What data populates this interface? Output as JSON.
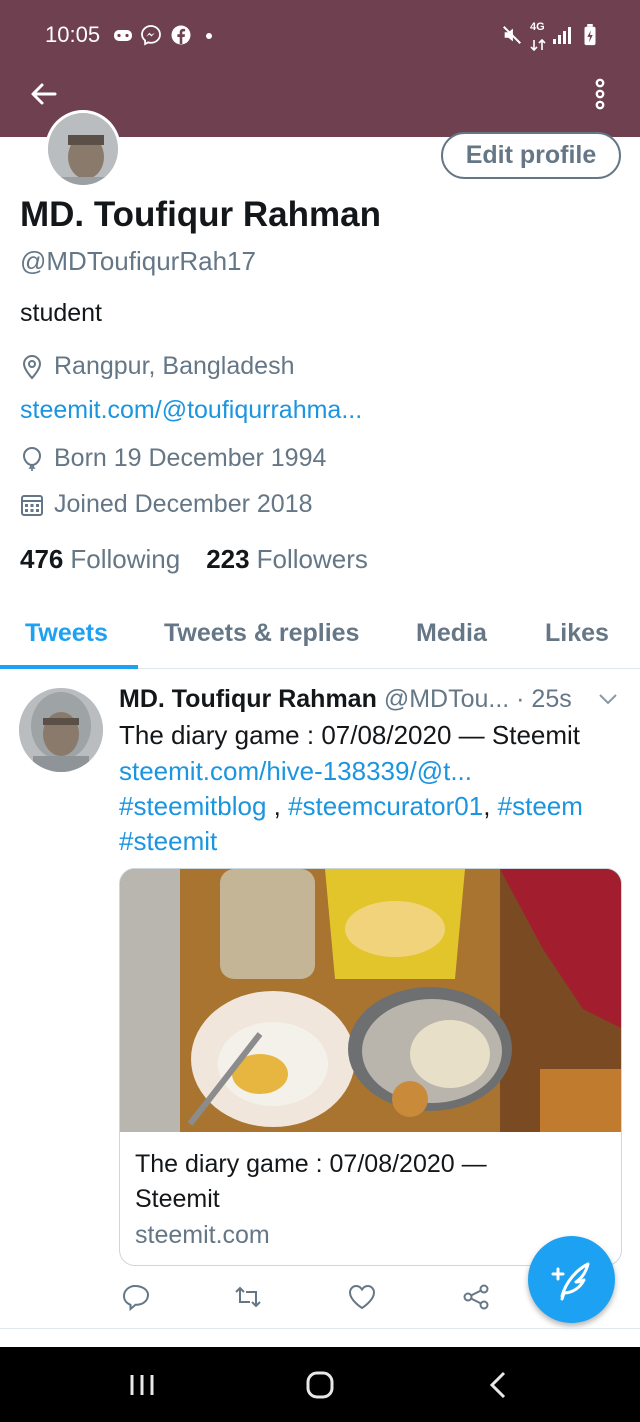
{
  "status_bar": {
    "time": "10:05",
    "network": "4G",
    "icons": [
      "game-icon",
      "messenger-icon",
      "facebook-icon",
      "dot-icon",
      "mute-icon",
      "signal-icon",
      "battery-icon"
    ]
  },
  "app_bar": {
    "back_icon": "arrow-left-icon",
    "more_icon": "vertical-dots-icon"
  },
  "profile": {
    "edit_label": "Edit profile",
    "name": "MD. Toufiqur Rahman",
    "handle": "@MDToufiqurRah17",
    "bio": "student",
    "location": "Rangpur, Bangladesh",
    "website": "steemit.com/@toufiqurrahma...",
    "born": "Born 19 December 1994",
    "joined": "Joined December 2018",
    "following_count": "476",
    "following_label": "Following",
    "followers_count": "223",
    "followers_label": "Followers"
  },
  "tabs": [
    {
      "label": "Tweets",
      "active": true
    },
    {
      "label": "Tweets & replies",
      "active": false
    },
    {
      "label": "Media",
      "active": false
    },
    {
      "label": "Likes",
      "active": false
    }
  ],
  "tweet": {
    "author": "MD. Toufiqur Rahman",
    "handle_time": "@MDTou... · 25s",
    "text_line1": "The diary game : 07/08/2020 — Steemit",
    "link": "steemit.com/hive-138339/@t...",
    "tag1": "#steemitblog",
    "sep1": " , ",
    "tag2": "#steemcurator01",
    "sep2": ", ",
    "tag3": "#steem",
    "tag4": "#steemit",
    "card": {
      "title": "The diary game : 07/08/2020 — Steemit",
      "domain": "steemit.com"
    }
  },
  "colors": {
    "app_bar": "#6f404f",
    "accent": "#1da1f2",
    "link": "#1b95e0",
    "secondary_text": "#657786"
  }
}
